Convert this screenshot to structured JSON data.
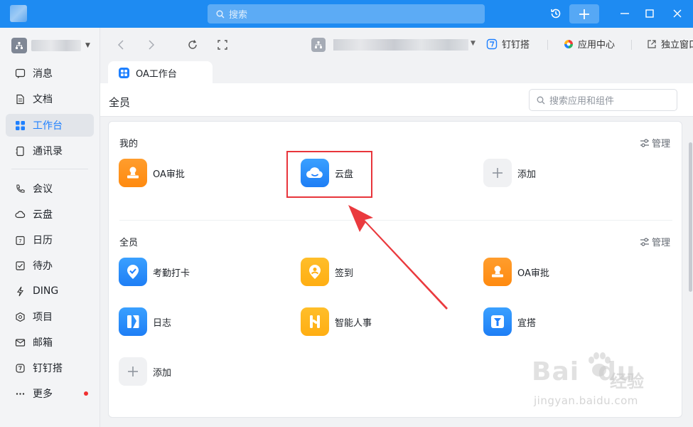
{
  "titlebar": {
    "search_placeholder": "搜索"
  },
  "sidebar": {
    "items": [
      {
        "label": "消息",
        "icon": "message-icon"
      },
      {
        "label": "文档",
        "icon": "document-icon"
      },
      {
        "label": "工作台",
        "icon": "workbench-icon",
        "active": true
      },
      {
        "label": "通讯录",
        "icon": "contacts-icon"
      },
      {
        "label": "会议",
        "icon": "meeting-icon"
      },
      {
        "label": "云盘",
        "icon": "cloud-drive-icon"
      },
      {
        "label": "日历",
        "icon": "calendar-icon"
      },
      {
        "label": "待办",
        "icon": "todo-icon"
      },
      {
        "label": "DING",
        "icon": "ding-icon"
      },
      {
        "label": "项目",
        "icon": "project-icon"
      },
      {
        "label": "邮箱",
        "icon": "mail-icon"
      },
      {
        "label": "钉钉搭",
        "icon": "dingda-icon"
      },
      {
        "label": "更多",
        "icon": "more-icon",
        "badge": "red-dot"
      }
    ]
  },
  "toolbar": {
    "links": [
      {
        "label": "钉钉搭"
      },
      {
        "label": "应用中心"
      },
      {
        "label": "独立窗口"
      }
    ]
  },
  "tab": {
    "label": "OA工作台"
  },
  "page": {
    "title": "全员",
    "search_placeholder": "搜索应用和组件"
  },
  "sections": {
    "mine": {
      "title": "我的",
      "manage": "管理",
      "apps": [
        {
          "label": "OA审批",
          "icon": "approval-icon",
          "color": "#ff8f1f"
        },
        {
          "label": "云盘",
          "icon": "cloud-drive-icon",
          "color": "#1e80ff"
        },
        {
          "label": "添加",
          "icon": "plus-icon"
        }
      ]
    },
    "all": {
      "title": "全员",
      "manage": "管理",
      "apps": [
        {
          "label": "考勤打卡",
          "icon": "attendance-icon",
          "color": "#1e80ff"
        },
        {
          "label": "签到",
          "icon": "checkin-icon",
          "color": "#ffb21a"
        },
        {
          "label": "OA审批",
          "icon": "approval-icon",
          "color": "#ff8f1f"
        },
        {
          "label": "日志",
          "icon": "log-icon",
          "color": "#1e80ff"
        },
        {
          "label": "智能人事",
          "icon": "hr-icon",
          "color": "#ffb21a"
        },
        {
          "label": "宜搭",
          "icon": "yida-icon",
          "color": "#1e80ff"
        },
        {
          "label": "添加",
          "icon": "plus-icon"
        }
      ]
    }
  },
  "watermark": {
    "brand": "Bai",
    "brand2": "du",
    "cn": "经验",
    "url": "jingyan.baidu.com"
  }
}
